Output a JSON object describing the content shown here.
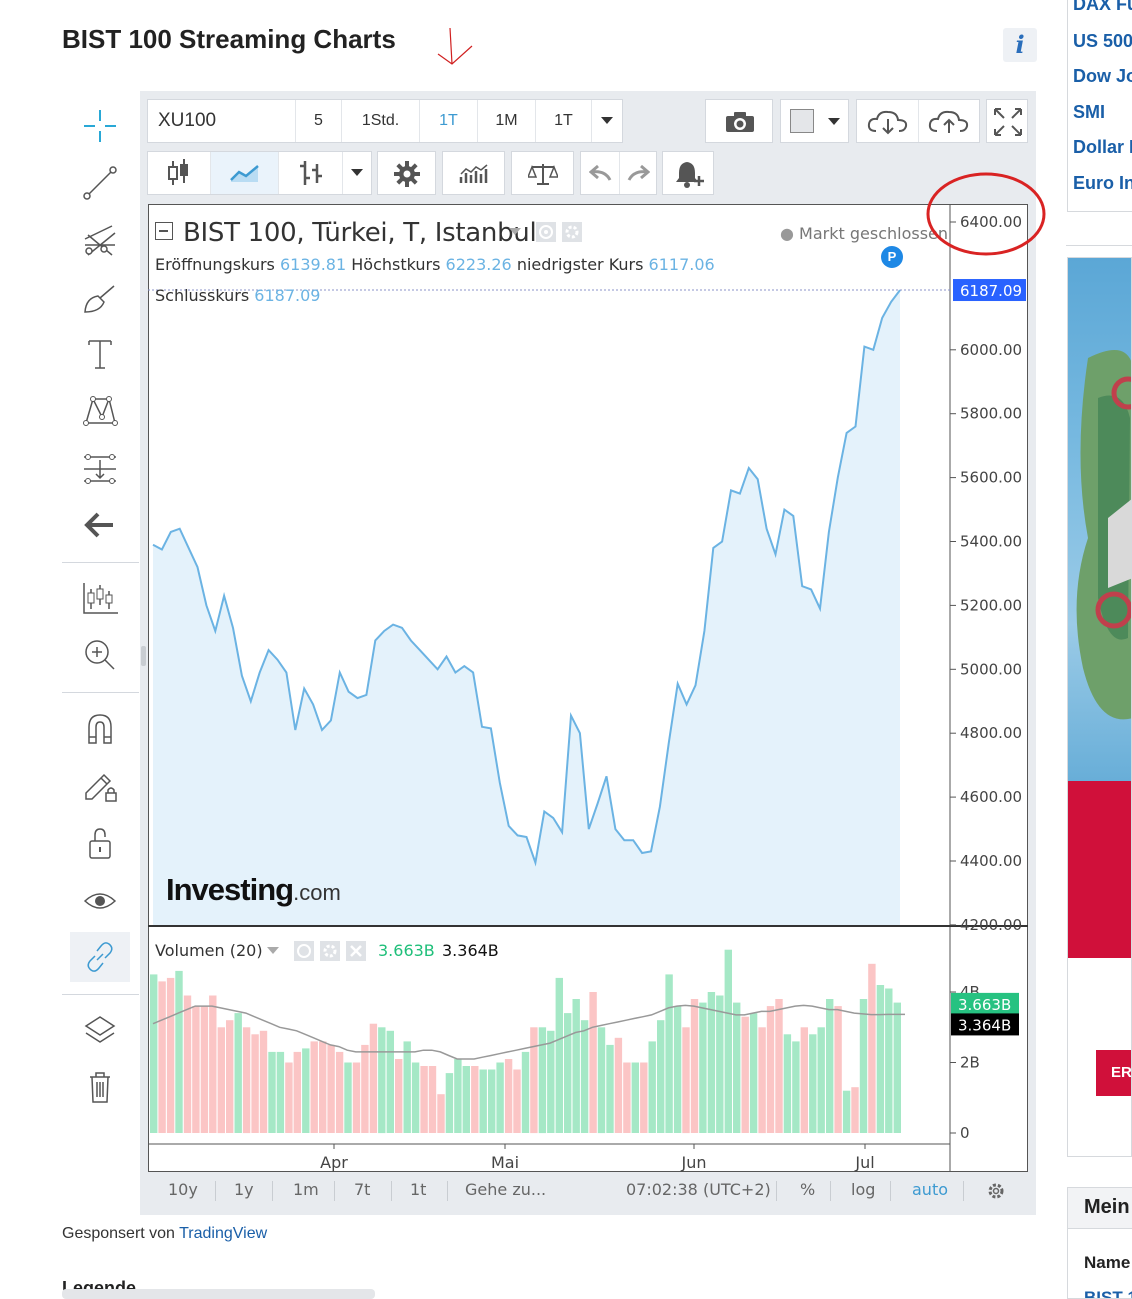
{
  "page": {
    "title": "BIST 100 Streaming Charts",
    "info_label": "i",
    "sponsor_prefix": "Gesponsert von",
    "sponsor_link": "TradingView",
    "legend_heading": "Legende"
  },
  "toolbar": {
    "symbol": "XU100",
    "intervals": [
      "5",
      "1Std.",
      "1T",
      "1M",
      "1T"
    ],
    "active_interval_index": 2
  },
  "chart": {
    "legend_title": "BIST 100, Türkei, T, Istanbul",
    "market_status": "Markt geschlossen",
    "marker_label": "P",
    "open_label": "Eröffnungskurs",
    "open": "6139.81",
    "high_label": "Höchstkurs",
    "high": "6223.26",
    "low_label": "niedrigster Kurs",
    "low": "6117.06",
    "close_label": "Schlusskurs",
    "close": "6187.09",
    "watermark_main": "Investing",
    "watermark_suffix": ".com",
    "volume_label": "Volumen (20)",
    "volume_value": "3.663B",
    "volume_ma_value": "3.364B"
  },
  "chart_data": {
    "type": "area",
    "price_axis": [
      "6400.00",
      "6187.09",
      "6000.00",
      "5800.00",
      "5600.00",
      "5400.00",
      "5200.00",
      "5000.00",
      "4800.00",
      "4600.00",
      "4400.00",
      "4200.00"
    ],
    "volume_axis": [
      "4B",
      "3.663B",
      "3.364B",
      "2B",
      "0"
    ],
    "x_ticks": [
      "Apr",
      "Mai",
      "Jun",
      "Jul"
    ],
    "accent_color": "#6bb3e3",
    "price_series": [
      5390,
      5375,
      5430,
      5440,
      5380,
      5320,
      5200,
      5120,
      5230,
      5130,
      4980,
      4900,
      4990,
      5060,
      5030,
      4990,
      4810,
      4940,
      4890,
      4810,
      4840,
      4990,
      4930,
      4910,
      4920,
      5090,
      5120,
      5140,
      5130,
      5090,
      5060,
      5030,
      5000,
      5040,
      4990,
      5010,
      4990,
      4820,
      4815,
      4645,
      4510,
      4480,
      4475,
      4395,
      4555,
      4535,
      4490,
      4855,
      4800,
      4500,
      4580,
      4665,
      4500,
      4465,
      4465,
      4425,
      4430,
      4570,
      4770,
      4955,
      4890,
      4950,
      5120,
      5380,
      5400,
      5560,
      5550,
      5630,
      5595,
      5440,
      5360,
      5500,
      5480,
      5260,
      5250,
      5190,
      5430,
      5600,
      5740,
      5760,
      6010,
      6000,
      6100,
      6150,
      6187
    ],
    "volume_series": [
      {
        "v": 4.5,
        "up": 1
      },
      {
        "v": 4.3,
        "up": 0
      },
      {
        "v": 4.4,
        "up": 0
      },
      {
        "v": 4.6,
        "up": 1
      },
      {
        "v": 3.9,
        "up": 0
      },
      {
        "v": 3.6,
        "up": 0
      },
      {
        "v": 3.6,
        "up": 0
      },
      {
        "v": 3.9,
        "up": 0
      },
      {
        "v": 3.0,
        "up": 0
      },
      {
        "v": 3.2,
        "up": 0
      },
      {
        "v": 3.4,
        "up": 1
      },
      {
        "v": 3.0,
        "up": 0
      },
      {
        "v": 2.8,
        "up": 0
      },
      {
        "v": 2.9,
        "up": 0
      },
      {
        "v": 2.3,
        "up": 1
      },
      {
        "v": 2.3,
        "up": 1
      },
      {
        "v": 2.0,
        "up": 0
      },
      {
        "v": 2.3,
        "up": 0
      },
      {
        "v": 2.4,
        "up": 1
      },
      {
        "v": 2.6,
        "up": 0
      },
      {
        "v": 2.6,
        "up": 0
      },
      {
        "v": 2.5,
        "up": 0
      },
      {
        "v": 2.3,
        "up": 0
      },
      {
        "v": 2.0,
        "up": 1
      },
      {
        "v": 2.0,
        "up": 0
      },
      {
        "v": 2.5,
        "up": 0
      },
      {
        "v": 3.1,
        "up": 0
      },
      {
        "v": 3.0,
        "up": 1
      },
      {
        "v": 2.9,
        "up": 1
      },
      {
        "v": 2.1,
        "up": 0
      },
      {
        "v": 2.6,
        "up": 1
      },
      {
        "v": 2.0,
        "up": 1
      },
      {
        "v": 1.9,
        "up": 0
      },
      {
        "v": 1.9,
        "up": 0
      },
      {
        "v": 1.1,
        "up": 0
      },
      {
        "v": 1.7,
        "up": 1
      },
      {
        "v": 2.1,
        "up": 1
      },
      {
        "v": 1.9,
        "up": 1
      },
      {
        "v": 1.9,
        "up": 0
      },
      {
        "v": 1.8,
        "up": 1
      },
      {
        "v": 1.8,
        "up": 1
      },
      {
        "v": 2.0,
        "up": 1
      },
      {
        "v": 2.1,
        "up": 0
      },
      {
        "v": 1.8,
        "up": 0
      },
      {
        "v": 2.3,
        "up": 1
      },
      {
        "v": 3.0,
        "up": 0
      },
      {
        "v": 3.0,
        "up": 1
      },
      {
        "v": 2.9,
        "up": 1
      },
      {
        "v": 4.4,
        "up": 1
      },
      {
        "v": 3.4,
        "up": 1
      },
      {
        "v": 3.8,
        "up": 1
      },
      {
        "v": 3.2,
        "up": 1
      },
      {
        "v": 4.0,
        "up": 0
      },
      {
        "v": 3.0,
        "up": 1
      },
      {
        "v": 2.5,
        "up": 1
      },
      {
        "v": 2.7,
        "up": 0
      },
      {
        "v": 2.0,
        "up": 0
      },
      {
        "v": 2.0,
        "up": 1
      },
      {
        "v": 2.0,
        "up": 0
      },
      {
        "v": 2.6,
        "up": 1
      },
      {
        "v": 3.2,
        "up": 1
      },
      {
        "v": 4.5,
        "up": 1
      },
      {
        "v": 3.6,
        "up": 1
      },
      {
        "v": 3.0,
        "up": 0
      },
      {
        "v": 3.8,
        "up": 0
      },
      {
        "v": 3.7,
        "up": 1
      },
      {
        "v": 4.0,
        "up": 1
      },
      {
        "v": 3.9,
        "up": 1
      },
      {
        "v": 5.2,
        "up": 1
      },
      {
        "v": 3.7,
        "up": 1
      },
      {
        "v": 3.3,
        "up": 0
      },
      {
        "v": 3.4,
        "up": 1
      },
      {
        "v": 3.0,
        "up": 0
      },
      {
        "v": 3.6,
        "up": 0
      },
      {
        "v": 3.8,
        "up": 0
      },
      {
        "v": 2.8,
        "up": 1
      },
      {
        "v": 2.6,
        "up": 1
      },
      {
        "v": 3.0,
        "up": 0
      },
      {
        "v": 2.8,
        "up": 1
      },
      {
        "v": 3.0,
        "up": 1
      },
      {
        "v": 3.8,
        "up": 1
      },
      {
        "v": 3.6,
        "up": 0
      },
      {
        "v": 1.2,
        "up": 1
      },
      {
        "v": 1.3,
        "up": 0
      },
      {
        "v": 3.8,
        "up": 1
      },
      {
        "v": 4.8,
        "up": 0
      },
      {
        "v": 4.2,
        "up": 1
      },
      {
        "v": 4.1,
        "up": 1
      },
      {
        "v": 3.7,
        "up": 1
      }
    ],
    "ma_series": [
      3.1,
      3.2,
      3.3,
      3.4,
      3.5,
      3.6,
      3.6,
      3.6,
      3.55,
      3.5,
      3.45,
      3.4,
      3.3,
      3.2,
      3.1,
      3.0,
      2.95,
      2.9,
      2.8,
      2.7,
      2.6,
      2.5,
      2.45,
      2.35,
      2.3,
      2.3,
      2.3,
      2.3,
      2.3,
      2.3,
      2.3,
      2.3,
      2.35,
      2.35,
      2.3,
      2.2,
      2.1,
      2.1,
      2.1,
      2.15,
      2.2,
      2.25,
      2.3,
      2.35,
      2.4,
      2.45,
      2.5,
      2.55,
      2.65,
      2.75,
      2.85,
      2.9,
      3.0,
      3.05,
      3.1,
      3.15,
      3.2,
      3.25,
      3.3,
      3.35,
      3.45,
      3.55,
      3.6,
      3.62,
      3.6,
      3.55,
      3.5,
      3.45,
      3.4,
      3.35,
      3.35,
      3.4,
      3.45,
      3.45,
      3.5,
      3.55,
      3.6,
      3.62,
      3.6,
      3.55,
      3.5,
      3.5,
      3.45,
      3.4,
      3.38,
      3.36,
      3.36,
      3.364,
      3.364,
      3.364
    ]
  },
  "bottom": {
    "ranges": [
      "10y",
      "1y",
      "1m",
      "7t",
      "1t"
    ],
    "goto": "Gehe zu...",
    "time": "07:02:38 (UTC+2)",
    "percent": "%",
    "log": "log",
    "auto": "auto"
  },
  "sidebar": {
    "links": [
      "DAX Fu",
      "US 500",
      "Dow Jo",
      "SMI",
      "Dollar I",
      "Euro In"
    ],
    "box_title": "Mein",
    "box_col": "Name",
    "box_row": "BIST 1",
    "ad_button": "ER"
  }
}
